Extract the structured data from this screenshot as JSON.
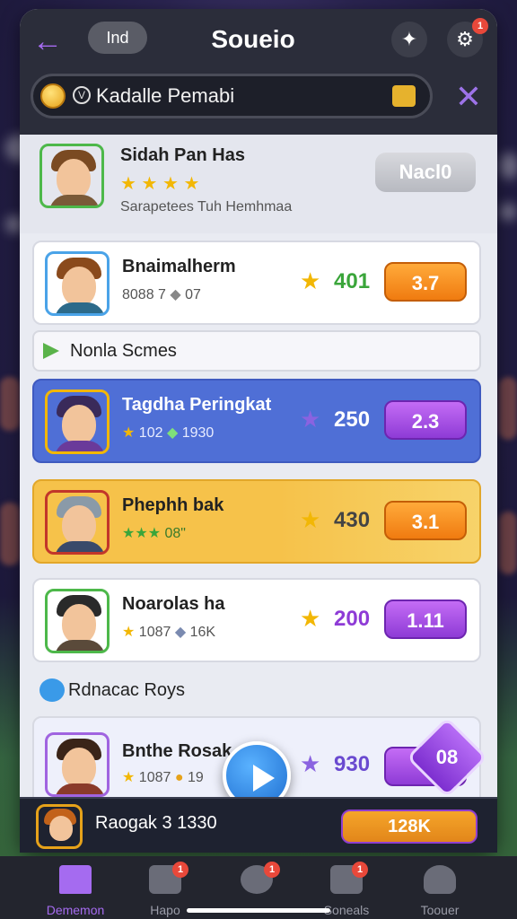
{
  "header": {
    "back_icon": "back-arrow-icon",
    "tag": "Ind",
    "title": "Soueio",
    "action_icon": "bookmark-icon",
    "settings_icon": "gear-icon",
    "settings_badge": "1"
  },
  "search": {
    "value": "Kadalle Pemabi",
    "coin_icon": "coin-icon",
    "lock_icon": "lock-icon",
    "close_icon": "close-icon"
  },
  "top_card": {
    "name": "Sidah Pan Has",
    "stars": "★ ★ ★",
    "subtitle": "Sarapetees Tuh Hemhmaa",
    "button": "Nacl0"
  },
  "rows": [
    {
      "name": "Bnaimalherm",
      "meta": "8088 7",
      "meta2": "07",
      "score": "401",
      "score_color": "#3aa53a",
      "button": "3.7",
      "button_style": "orange",
      "card_bg": "#ffffff"
    },
    {
      "section": "Nonla Scmes"
    },
    {
      "name": "Tagdha Peringkat",
      "meta": "102",
      "meta2": "1930",
      "score": "250",
      "score_color": "#ffffff",
      "button": "2.3",
      "button_style": "purple",
      "card_bg": "#4f6fd6"
    },
    {
      "name": "Phephh bak",
      "meta": "★★★",
      "meta2": "08\"",
      "score": "430",
      "score_color": "#444444",
      "button": "3.1",
      "button_style": "orange",
      "card_bg": "#f6c24a"
    },
    {
      "name": "Noarolas ha",
      "meta": "1087",
      "meta2": "16K",
      "score": "200",
      "score_color": "#8e3bd6",
      "button": "1.11",
      "button_style": "purple",
      "card_bg": "#ffffff"
    },
    {
      "section": "Rdnacac Roys"
    },
    {
      "name": "Bnthe Rosak",
      "meta": "1087",
      "meta2": "19",
      "score": "930",
      "score_color": "#6a4ad0",
      "button": "",
      "button_style": "purple",
      "card_bg": "#eef0fb"
    }
  ],
  "diamond": "08",
  "footer": {
    "name": "Raogak 3 1330",
    "pill": "128K"
  },
  "bottom_nav": [
    {
      "label": "Dememon",
      "icon": "home-icon",
      "active": true
    },
    {
      "label": "Hapo",
      "icon": "chat-icon",
      "badge": "1"
    },
    {
      "label": "",
      "icon": "comment-icon",
      "badge": "1"
    },
    {
      "label": "Soneals",
      "icon": "cards-icon",
      "badge": "1"
    },
    {
      "label": "Toouer",
      "icon": "profile-icon"
    }
  ],
  "colors": {
    "accent_purple": "#8e3bd6",
    "accent_orange": "#f07b10",
    "accent_blue": "#4f6fd6",
    "accent_yellow": "#f6c24a"
  }
}
